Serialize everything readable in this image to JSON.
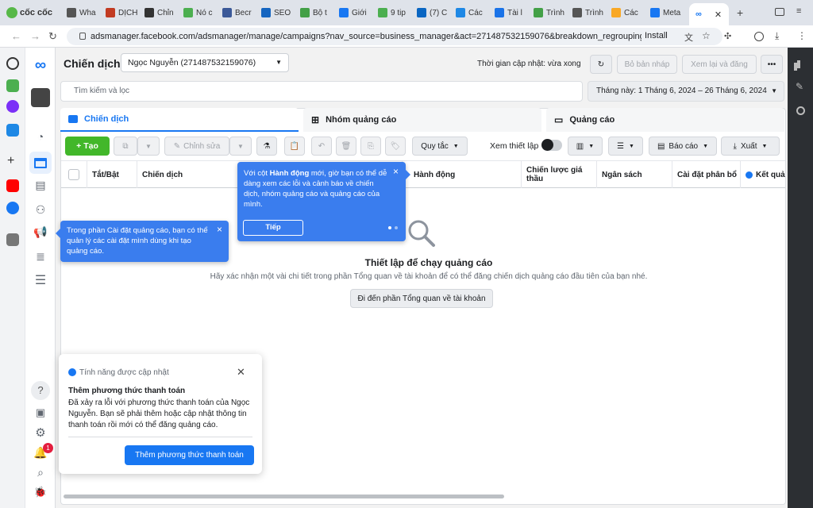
{
  "browser": {
    "brand": "cốc cốc",
    "tabs": [
      {
        "label": "Wha",
        "color": "#555"
      },
      {
        "label": "DỊCH",
        "color": "#c23b22"
      },
      {
        "label": "Chỉn",
        "color": "#333"
      },
      {
        "label": "Nó c",
        "color": "#4caf50"
      },
      {
        "label": "Becr",
        "color": "#3b5998"
      },
      {
        "label": "SEO",
        "color": "#1565c0"
      },
      {
        "label": "Bộ t",
        "color": "#43a047"
      },
      {
        "label": "Giới",
        "color": "#1877f2"
      },
      {
        "label": "9 tip",
        "color": "#4caf50"
      },
      {
        "label": "(7) C",
        "color": "#0a66c2"
      },
      {
        "label": "Các",
        "color": "#1e88e5"
      },
      {
        "label": "Tài l",
        "color": "#1a73e8"
      },
      {
        "label": "Trình",
        "color": "#43a047"
      },
      {
        "label": "Trình",
        "color": "#555"
      },
      {
        "label": "Các",
        "color": "#f9a825"
      },
      {
        "label": "Meta",
        "color": "#1877f2"
      }
    ],
    "url": "adsmanager.facebook.com/adsmanager/manage/campaigns?nav_source=business_manager&act=271487532159076&breakdown_regrouping=1",
    "install_label": "Install"
  },
  "header": {
    "title": "Chiến dịch",
    "account": "Ngọc Nguyễn (271487532159076)",
    "update_status": "Thời gian cập nhật: vừa xong",
    "draft_btn": "Bỏ bản nháp",
    "review_btn": "Xem lại và đăng",
    "more": "•••"
  },
  "search": {
    "placeholder": "Tìm kiếm và lọc"
  },
  "daterange": "Tháng này: 1 Tháng 6, 2024 – 26 Tháng 6, 2024",
  "level_tabs": [
    {
      "label": "Chiến dịch"
    },
    {
      "label": "Nhóm quảng cáo"
    },
    {
      "label": "Quảng cáo"
    }
  ],
  "toolbar": {
    "create": "+ Tạo",
    "edit": "Chỉnh sửa",
    "rules": "Quy tắc",
    "view_setup": "Xem thiết lập",
    "report": "Báo cáo",
    "export": "Xuất"
  },
  "table_headers": [
    "Tắt/Bật",
    "Chiến dịch",
    "Hành động",
    "Chiến lược giá thầu",
    "Ngân sách",
    "Cài đặt phân bổ",
    "Kết quả"
  ],
  "empty": {
    "title": "Thiết lập để chạy quảng cáo",
    "desc": "Hãy xác nhận một vài chi tiết trong phần Tổng quan về tài khoản để có thể đăng chiến dịch quảng cáo đầu tiên của bạn nhé.",
    "button": "Đi đến phần Tổng quan về tài khoản"
  },
  "tooltip_settings": {
    "text": "Trong phần Cài đặt quảng cáo, bạn có thể quản lý các cài đặt mình dùng khi tạo quảng cáo.",
    "close": "×"
  },
  "tooltip_actions": {
    "pre": "Với cột ",
    "bold": "Hành động",
    "post": " mới, giờ bạn có thể dễ dàng xem các lỗi và cảnh báo về chiến dịch, nhóm quảng cáo và quảng cáo của mình.",
    "next": "Tiếp",
    "close": "×"
  },
  "notice": {
    "header": "Tính năng được cập nhật",
    "title": "Thêm phương thức thanh toán",
    "body": "Đã xảy ra lỗi với phương thức thanh toán của Ngọc Nguyễn. Bạn sẽ phải thêm hoặc cập nhật thông tin thanh toán rồi mới có thể đăng quảng cáo.",
    "button": "Thêm phương thức thanh toán",
    "close": "✕"
  },
  "notif_count": "1",
  "help": "?",
  "colors": {
    "brand_blue": "#1877f2",
    "tooltip": "#3a7dee",
    "create_green": "#42b72a"
  }
}
